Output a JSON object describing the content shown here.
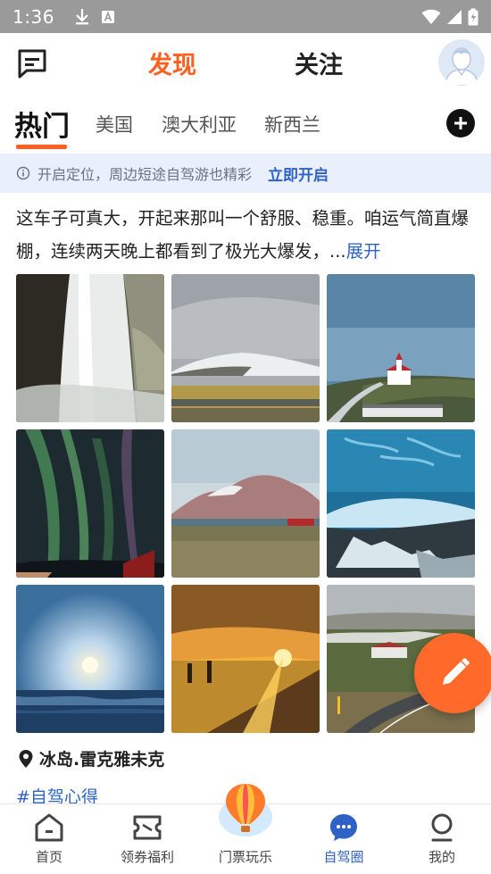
{
  "status_bar": {
    "time": "1:36"
  },
  "top_nav": {
    "tabs": [
      "发现",
      "关注"
    ],
    "active": "发现"
  },
  "categories": {
    "items": [
      "热门",
      "美国",
      "澳大利亚",
      "新西兰"
    ],
    "active": "热门"
  },
  "location_banner": {
    "text": "开启定位，周边短途自驾游也精彩",
    "action": "立即开启"
  },
  "post": {
    "text": "这车子可真大，开起来那叫一个舒服、稳重。咱运气简直爆棚，连续两天晚上都看到了极光大爆发，...",
    "expand": "展开",
    "photos": [
      "waterfall",
      "snow-mountain",
      "red-church",
      "aurora",
      "mountain-lake",
      "ice-cave",
      "sun-over-sea",
      "sunset-field",
      "road-village"
    ],
    "location": "冰岛.雷克雅未克",
    "topic": "#自驾心得"
  },
  "bottom_nav": {
    "items": [
      {
        "label": "首页",
        "icon": "home-icon"
      },
      {
        "label": "领券福利",
        "icon": "coupon-icon"
      },
      {
        "label": "门票玩乐",
        "icon": "balloon-icon"
      },
      {
        "label": "自驾圈",
        "icon": "chat-bubble-icon"
      },
      {
        "label": "我的",
        "icon": "profile-icon"
      }
    ],
    "active": "自驾圈"
  },
  "colors": {
    "accent": "#ff5f1f",
    "link": "#2e62c4",
    "banner": "#e9f0fb"
  }
}
